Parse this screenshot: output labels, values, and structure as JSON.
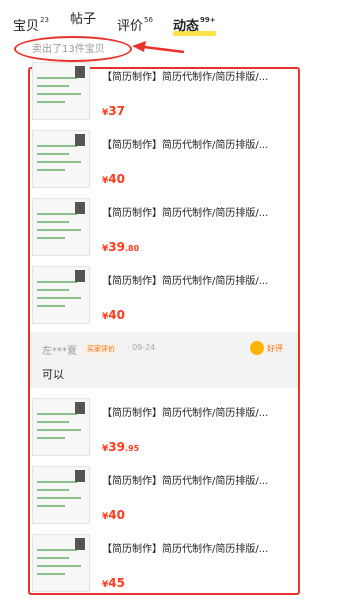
{
  "tabs": [
    {
      "label": "宝贝",
      "count": "23"
    },
    {
      "label": "帖子",
      "count": ""
    },
    {
      "label": "评价",
      "count": "56"
    },
    {
      "label": "动态",
      "count": "99+"
    }
  ],
  "sold_summary": "卖出了13件宝贝",
  "products": [
    {
      "title": "【简历制作】简历代制作/简历排版/...",
      "price_int": "37",
      "price_dec": ""
    },
    {
      "title": "【简历制作】简历代制作/简历排版/...",
      "price_int": "40",
      "price_dec": ""
    },
    {
      "title": "【简历制作】简历代制作/简历排版/...",
      "price_int": "39",
      "price_dec": ".80"
    },
    {
      "title": "【简历制作】简历代制作/简历排版/...",
      "price_int": "40",
      "price_dec": ""
    },
    {
      "title": "【简历制作】简历代制作/简历排版/...",
      "price_int": "39",
      "price_dec": ".95"
    },
    {
      "title": "【简历制作】简历代制作/简历排版/...",
      "price_int": "40",
      "price_dec": ""
    },
    {
      "title": "【简历制作】简历代制作/简历排版/...",
      "price_int": "45",
      "price_dec": ""
    }
  ],
  "currency": "¥",
  "review": {
    "user": "左***夏",
    "badge": "买家评价",
    "date": "· 09-24",
    "rating": "好评",
    "text": "可以"
  },
  "colors": {
    "accent": "#ff3b1f",
    "annotation": "#e8332a",
    "tab_highlight": "#ffe24a"
  }
}
